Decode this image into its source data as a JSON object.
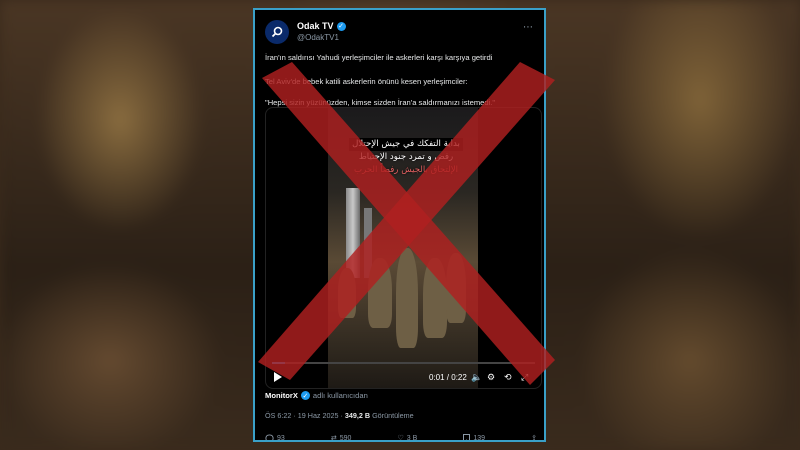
{
  "tweet": {
    "display_name": "Odak TV",
    "handle": "@OdakTV1",
    "line1": "İran'ın saldırısı Yahudi yerleşimciler ile askerleri karşı karşıya getirdi",
    "line2": "Tel Aviv'de bebek katili askerlerin önünü kesen yerleşimciler:",
    "line3": "\"Hepsi sizin yüzünüzden, kimse sizden İran'a saldırmanızı istemedi.\"",
    "video": {
      "overlay_line1": "بداية التفكك في جيش الإحتلال",
      "overlay_line2": "رفض و تمرد جنود الإحتياط",
      "overlay_line3": "الإلتحاق بالجيش رفضاً الحرب",
      "time": "0:01 / 0:22",
      "progress": 0.05
    },
    "source_name": "MonitorX",
    "source_suffix": "adlı kullanıcıdan",
    "timestamp": "ÖS 6:22 · 19 Haz 2025 · ",
    "views_count": "349,2 B",
    "views_label": " Görüntüleme",
    "replies": "93",
    "reposts": "590",
    "likes": "3 B",
    "bookmarks": "139"
  },
  "colors": {
    "frame": "#3aa0c8",
    "cross": "#b02020",
    "verified": "#1d9bf0"
  }
}
